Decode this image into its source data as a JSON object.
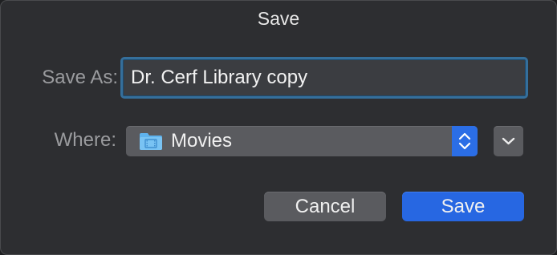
{
  "window": {
    "title": "Save"
  },
  "form": {
    "save_as_label": "Save As:",
    "save_as_value": "Dr. Cerf Library copy",
    "where_label": "Where:",
    "where_value": "Movies",
    "where_icon": "movies-folder-icon"
  },
  "buttons": {
    "cancel_label": "Cancel",
    "save_label": "Save"
  },
  "colors": {
    "dialog_background": "#2d2e31",
    "accent_blue": "#2767e2",
    "focus_ring": "#356f9b",
    "folder_blue": "#5fb3ee"
  }
}
